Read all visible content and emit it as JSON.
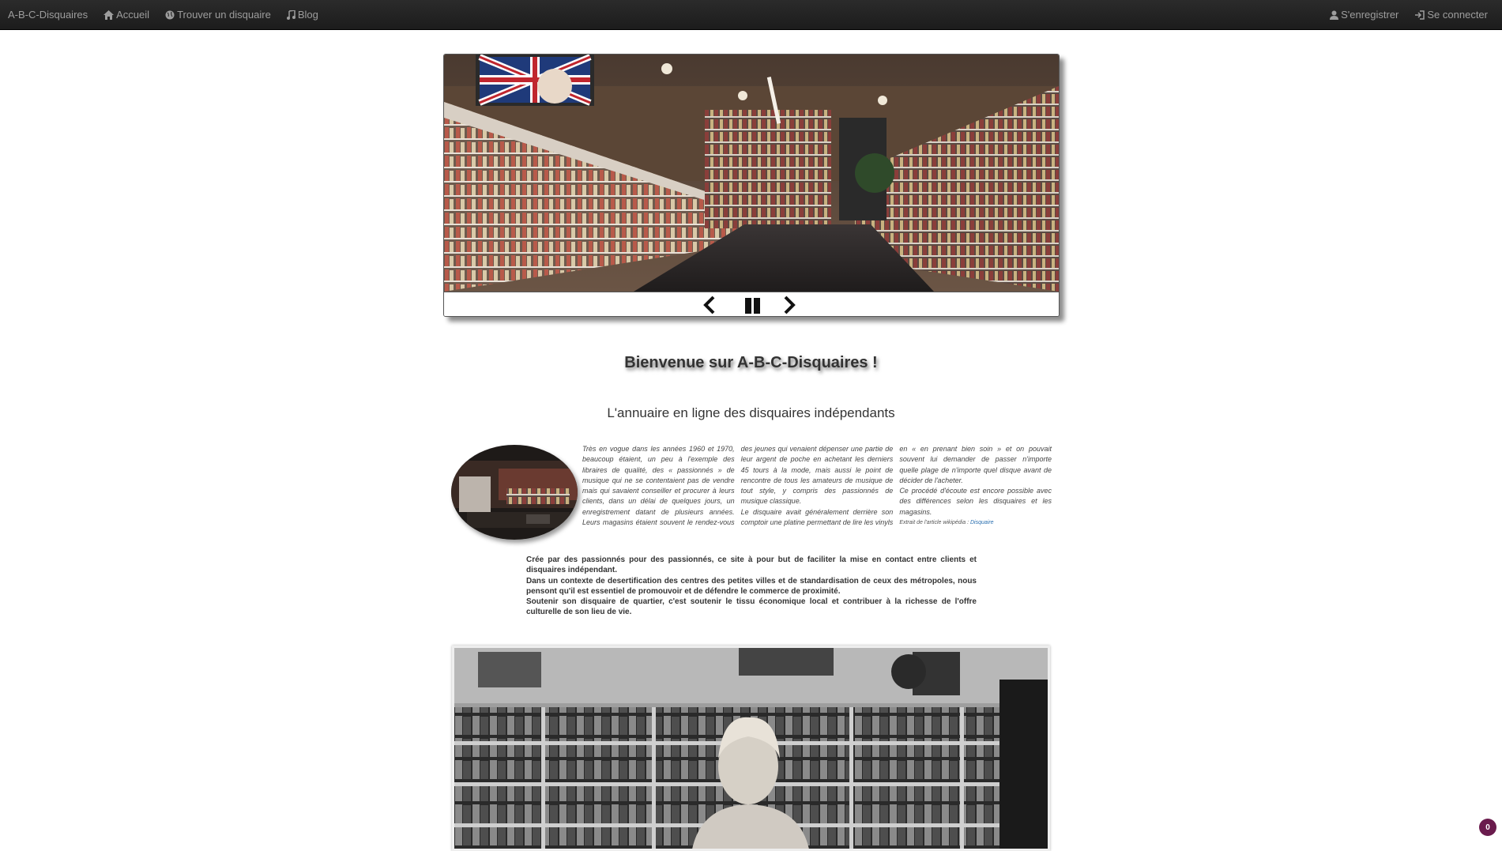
{
  "navbar": {
    "brand": "A-B-C-Disquaires",
    "left_items": [
      {
        "label": "Accueil",
        "icon": "home-icon"
      },
      {
        "label": "Trouver un disquaire",
        "icon": "globe-icon"
      },
      {
        "label": "Blog",
        "icon": "music-icon"
      }
    ],
    "right_items": [
      {
        "label": "S'enregistrer",
        "icon": "user-icon"
      },
      {
        "label": "Se connecter",
        "icon": "login-icon"
      }
    ]
  },
  "carousel": {
    "controls": [
      "previous",
      "pause",
      "next"
    ]
  },
  "welcome": {
    "title": "Bienvenue sur A-B-C-Disquaires !",
    "subtitle": "L'annuaire en ligne des disquaires indépendants"
  },
  "intro": {
    "paragraphs": [
      "Très en vogue dans les années 1960 et 1970, beaucoup étaient, un peu à l'exemple des libraires de qualité, des « passionnés » de musique qui ne se contentaient pas de vendre mais qui savaient conseiller et procurer à leurs clients, dans un délai de quelques jours, un enregistrement datant de plusieurs années. Leurs magasins étaient souvent le rendez-vous des jeunes qui venaient dépenser une partie de leur argent de poche en achetant les derniers 45 tours à la mode, mais aussi le point de rencontre de tous les amateurs de musique de tout style, y compris des passionnés de musique classique.",
      "Le disquaire avait généralement derrière son comptoir une platine permettant de lire les vinyls en « en prenant bien soin » et on pouvait souvent lui demander de passer n'importe quelle plage de n'importe quel disque avant de décider de l'acheter.",
      "Ce procédé d'écoute est encore possible avec des différences selon les disquaires et les magasins."
    ],
    "source_prefix": "Extrait de l'article wikipédia : ",
    "source_link": "Disquaire"
  },
  "mission": {
    "paragraphs": [
      "Crée par des passionnés pour des passionnés, ce site à pour but de faciliter la mise en contact entre clients et disquaires indépendant.",
      "Dans un contexte de desertification des centres des petites villes et de standardisation de ceux des métropoles, nous pensont qu'il est essentiel de promouvoir et de défendre le commerce de proximité.",
      "Soutenir son disquaire de quartier, c'est soutenir le tissu économique local et contribuer à la richesse de l'offre culturelle de son lieu de vie."
    ]
  },
  "badge": {
    "count": "0"
  }
}
